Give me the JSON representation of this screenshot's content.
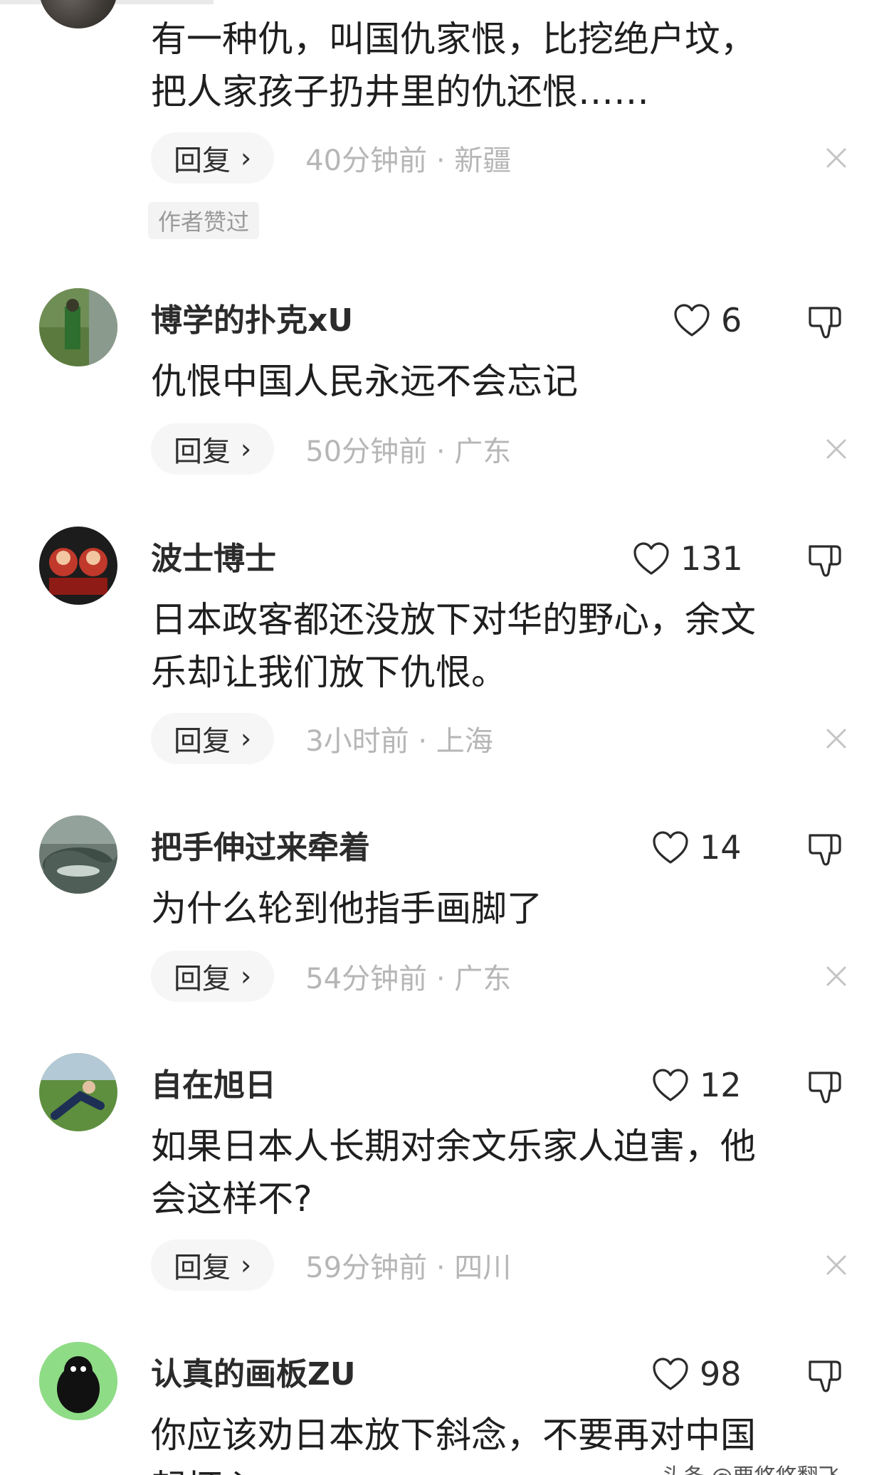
{
  "comments": [
    {
      "text": "有一种仇，叫国仇家恨，比挖绝户坟，\n把人家孩子扔井里的仇还恨……",
      "reply_label": "回复",
      "meta": "40分钟前 · 新疆",
      "author_tag": "作者赞过"
    },
    {
      "username": "博学的扑克xU",
      "likes": "6",
      "text": "仇恨中国人民永远不会忘记",
      "reply_label": "回复",
      "meta": "50分钟前 · 广东"
    },
    {
      "username": "波士博士",
      "likes": "131",
      "text": "日本政客都还没放下对华的野心，余文\n乐却让我们放下仇恨。",
      "reply_label": "回复",
      "meta": "3小时前 · 上海"
    },
    {
      "username": "把手伸过来牵着",
      "likes": "14",
      "text": "为什么轮到他指手画脚了",
      "reply_label": "回复",
      "meta": "54分钟前 · 广东"
    },
    {
      "username": "自在旭日",
      "likes": "12",
      "text": "如果日本人长期对余文乐家人迫害，他\n会这样不?",
      "reply_label": "回复",
      "meta": "59分钟前 · 四川"
    },
    {
      "username": "认真的画板ZU",
      "likes": "98",
      "text": "你应该劝日本放下斜念，不要再对中国\n起坏心"
    }
  ],
  "watermark": "头条 @要悠悠翻飞"
}
